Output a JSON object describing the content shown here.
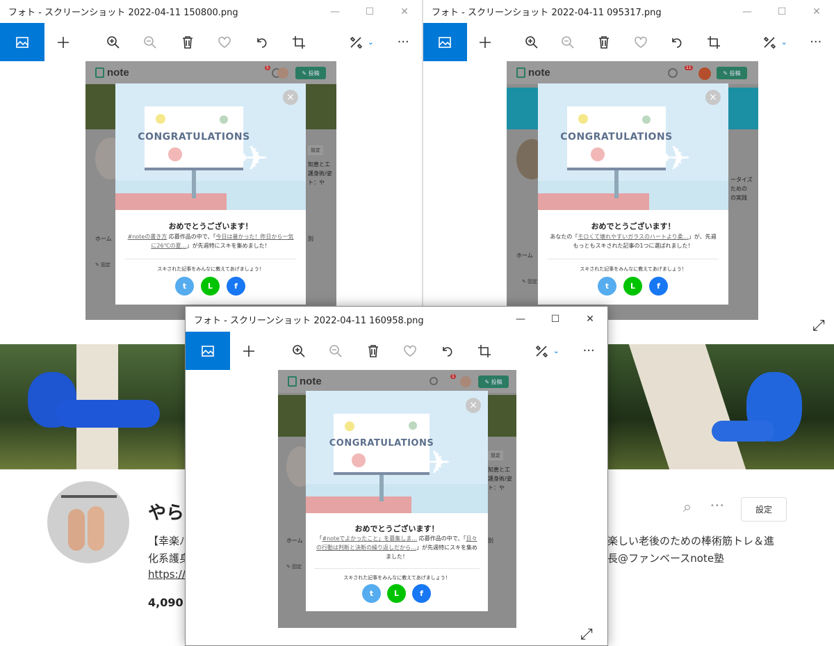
{
  "windows": {
    "left": {
      "title": "フォト - スクリーンショット 2022-04-11 150800.png"
    },
    "right": {
      "title": "フォト - スクリーンショット 2022-04-11 095317.png"
    },
    "front": {
      "title": "フォト - スクリーンショット 2022-04-11 160958.png"
    }
  },
  "window_controls": {
    "minimize": "—",
    "maximize": "☐",
    "close": "✕"
  },
  "toolbar_icons": [
    "image-icon",
    "add-icon",
    "zoom-in-icon",
    "zoom-out-icon",
    "delete-icon",
    "favorite-icon",
    "rotate-icon",
    "crop-icon",
    "edit-icon",
    "more-icon"
  ],
  "toolbar": {
    "more": "···",
    "chevron": "⌄"
  },
  "note": {
    "logo": "note",
    "post_button": "✎ 投稿",
    "notif_left": "5",
    "notif_right": "11",
    "notif_front": "1",
    "settings_label": "設定",
    "tab_home": "ホーム"
  },
  "congrats": {
    "billboard": "CONGRATULATIONS",
    "heading": "おめでとうございます！",
    "share": "スキされた記事をみんなに教えてあげましょう！",
    "close": "×"
  },
  "left_modal": {
    "link1": "#noteの書き方",
    "t1": " 応募作品の中で、「",
    "link2": "今日は暑かった！昨日から一気に26℃の夏…",
    "t2": "」が先週特にスキを集めました！"
  },
  "right_modal": {
    "t0": "あなたの「",
    "link1": "モロくて壊れやすいガラスのハートより柔…",
    "t1": "」が、先週もっともスキされた記事の1つに選ばれました！"
  },
  "front_modal": {
    "t0": "「",
    "link1": "#noteでよかったこと」を募集しま…",
    "t1": " 応募作品の中で、「",
    "link2": "日々の行動は判断と決断の繰り返しだから…",
    "t2": "」が先週特にスキを集めました！"
  },
  "profile": {
    "name": "やらi",
    "bio_left": "【幸楽ﾉ",
    "bio_left2": "化系護身",
    "link": "https://",
    "count": "4,090",
    "bio_right": "楽しい老後のための棒術筋トレ＆進",
    "bio_right2": "長@ファンベースnote塾",
    "settings": "設定"
  },
  "peeks": {
    "l1": "知恵と工",
    "l2": "護身術/姿",
    "l3": "ト：や",
    "r1": "ータイズ",
    "r2": "ための",
    "r3": "の実践",
    "lst": "別",
    "fixed": "✎ 固定"
  },
  "icons": {
    "twitter": "t",
    "line": "L",
    "facebook": "f",
    "search": "⌕",
    "dots": "•••",
    "resize": "⤢"
  }
}
